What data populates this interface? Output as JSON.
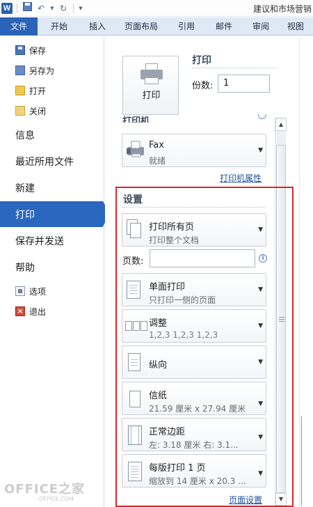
{
  "titlebar": {
    "logo": "W",
    "undo": "↶",
    "redo": "↻",
    "title": "建议和市场营销"
  },
  "tabs": [
    "文件",
    "开始",
    "插入",
    "页面布局",
    "引用",
    "邮件",
    "审阅",
    "视图"
  ],
  "nav": {
    "save": "保存",
    "save_as": "另存为",
    "open": "打开",
    "close": "关闭",
    "info": "信息",
    "recent": "最近所用文件",
    "new": "新建",
    "print": "打印",
    "save_send": "保存并发送",
    "help": "帮助",
    "options": "选项",
    "exit": "退出"
  },
  "print": {
    "button_label": "打印",
    "heading": "打印",
    "copies_label": "份数:",
    "copies_value": "1"
  },
  "printer": {
    "heading": "打印机",
    "name": "Fax",
    "status": "就绪",
    "properties_link": "打印机属性"
  },
  "settings": {
    "heading": "设置",
    "pages_label": "页数:",
    "pages_value": "",
    "items": [
      {
        "title": "打印所有页",
        "sub": "打印整个文档"
      },
      {
        "title": "单面打印",
        "sub": "只打印一侧的页面"
      },
      {
        "title": "调整",
        "sub": "1,2,3    1,2,3    1,2,3"
      },
      {
        "title": "纵向",
        "sub": ""
      },
      {
        "title": "信纸",
        "sub": "21.59 厘米 x 27.94 厘米"
      },
      {
        "title": "正常边距",
        "sub": "左: 3.18 厘米    右: 3.1..."
      },
      {
        "title": "每版打印 1 页",
        "sub": "缩放到 14 厘米 x 20.3 ..."
      }
    ],
    "page_setup_link": "页面设置"
  },
  "watermark": {
    "text": "OFFICE之家",
    "sub": "OFFICE.COM"
  }
}
